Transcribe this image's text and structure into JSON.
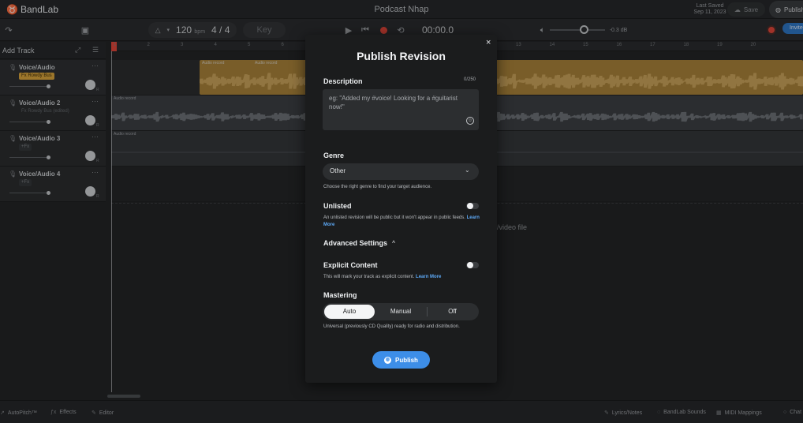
{
  "app": {
    "logo_text": "BandLab"
  },
  "header": {
    "project_title": "Podcast Nhap",
    "last_saved_label": "Last Saved",
    "last_saved_date": "Sep 11, 2023",
    "save_label": "Save",
    "publish_label": "Publish"
  },
  "transport": {
    "tempo_value": "120",
    "tempo_unit": "bpm",
    "time_signature": "4 / 4",
    "key_label": "Key",
    "timecode": "00:00.0",
    "volume_level": 0.6,
    "volume_db": "-0.3 dB",
    "invite_label": "Invite"
  },
  "tracks_panel": {
    "add_track_label": "Add Track",
    "tracks": [
      {
        "name": "Voice/Audio",
        "fx": "Fx Rowdy Bus"
      },
      {
        "name": "Voice/Audio 2",
        "fx": "Fx Rowdy Bus (edited)"
      },
      {
        "name": "Voice/Audio 3",
        "fx": "+Fx"
      },
      {
        "name": "Voice/Audio 4",
        "fx": "+Fx"
      }
    ]
  },
  "timeline": {
    "ruler": [
      "1",
      "2",
      "3",
      "4",
      "5",
      "6",
      "7",
      "8",
      "9",
      "10",
      "11",
      "12",
      "13",
      "14",
      "15",
      "16",
      "17",
      "18",
      "19",
      "20"
    ],
    "clip_label": "Audio record",
    "drop_hint": "/video file"
  },
  "bottom_bar": {
    "autopitch": "AutoPitch™",
    "effects": "Effects",
    "editor": "Editor",
    "lyrics": "Lyrics/Notes",
    "sounds": "BandLab Sounds",
    "midi": "MIDI Mappings",
    "chat": "Chat"
  },
  "modal": {
    "title": "Publish Revision",
    "close": "×",
    "description_label": "Description",
    "description_count": "0/250",
    "description_placeholder": "eg: \"Added my #voice! Looking for a #guitarist now!\"",
    "genre_label": "Genre",
    "genre_value": "Other",
    "genre_help": "Choose the right genre to find your target audience.",
    "unlisted_label": "Unlisted",
    "unlisted_help": "An unlisted revision will be public but it won't appear in public feeds.",
    "learn_more": "Learn More",
    "advanced_label": "Advanced Settings",
    "explicit_label": "Explicit Content",
    "explicit_help": "This will mark your track as explicit content.",
    "mastering_label": "Mastering",
    "mastering_options": [
      "Auto",
      "Manual",
      "Off"
    ],
    "mastering_selected": "Auto",
    "mastering_help": "Universal (previously CD Quality) ready for radio and distribution.",
    "publish_label": "Publish"
  }
}
